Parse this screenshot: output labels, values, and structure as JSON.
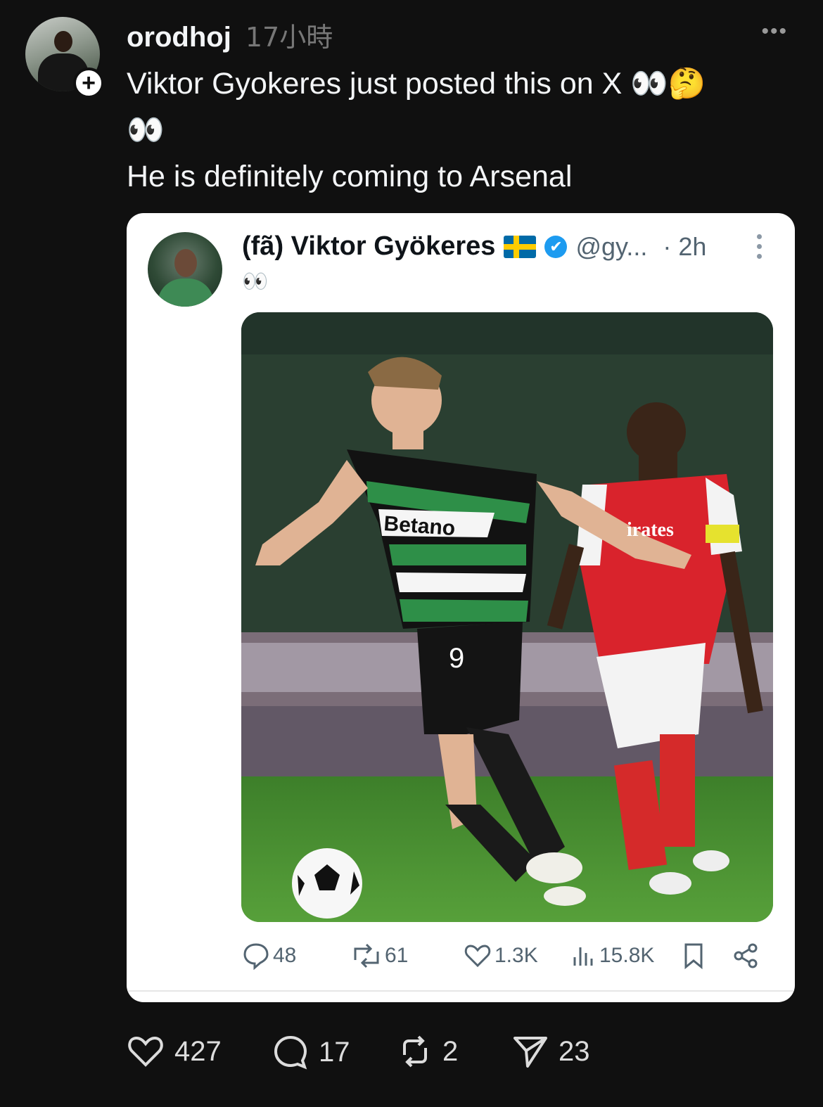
{
  "post": {
    "username": "orodhoj",
    "timestamp": "17小時",
    "more_icon": "ellipsis-icon",
    "text_line1": "Viktor Gyokeres just posted this on X",
    "emoji_1": "👀🤔",
    "emoji_2": "👀",
    "text_line3": "He is definitely coming to Arsenal"
  },
  "embedded_tweet": {
    "name": "(fã) Viktor Gyökeres",
    "flag": "Sweden flag",
    "verified": true,
    "handle": "@gy...",
    "time": "· 2h",
    "text": "👀",
    "image_text": {
      "sponsor": "Betano",
      "shirt_number": "9",
      "opponent_sponsor": "irates"
    },
    "stats": {
      "replies": "48",
      "reposts": "61",
      "likes": "1.3K",
      "views": "15.8K"
    }
  },
  "footer": {
    "likes": "427",
    "comments": "17",
    "reposts": "2",
    "shares": "23"
  },
  "colors": {
    "background": "#101010",
    "card": "#ffffff",
    "verified_blue": "#1d9bf0",
    "muted_text": "#536471"
  }
}
